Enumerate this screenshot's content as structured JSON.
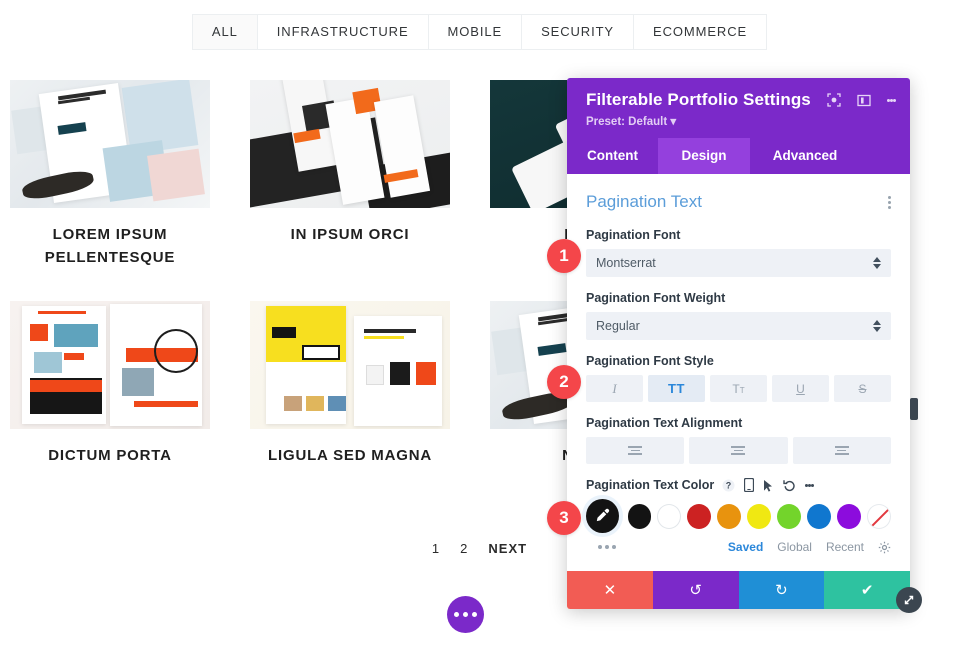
{
  "filter_bar": {
    "items": [
      {
        "label": "ALL",
        "active": true
      },
      {
        "label": "INFRASTRUCTURE",
        "active": false
      },
      {
        "label": "MOBILE",
        "active": false
      },
      {
        "label": "SECURITY",
        "active": false
      },
      {
        "label": "ECOMMERCE",
        "active": false
      }
    ]
  },
  "portfolio": {
    "items": [
      {
        "title": "LOREM IPSUM PELLENTESQUE",
        "thumb": "sunglasses-shop-mockup"
      },
      {
        "title": "IN IPSUM ORCI",
        "thumb": "mobile-app-orange-mockup"
      },
      {
        "title": "IPSUM",
        "thumb": "dark-teal-phone-mockup"
      },
      {
        "title": "DICTUM PORTA",
        "thumb": "bike-repair-orange-mockup"
      },
      {
        "title": "LIGULA SED MAGNA",
        "thumb": "yellow-strategy-mockup"
      },
      {
        "title": "NIBH P",
        "thumb": "sunglasses-shop-mockup-2"
      }
    ]
  },
  "pagination": {
    "pages": [
      "1",
      "2"
    ],
    "next_label": "NEXT"
  },
  "fab": {
    "name": "more-options-fab"
  },
  "markers": [
    {
      "number": "1"
    },
    {
      "number": "2"
    },
    {
      "number": "3"
    }
  ],
  "panel": {
    "title": "Filterable Portfolio Settings",
    "preset": "Preset: Default",
    "header_icons": [
      "focus-icon",
      "layout-columns-icon",
      "kebab-menu-icon"
    ],
    "tabs": [
      {
        "label": "Content",
        "active": false
      },
      {
        "label": "Design",
        "active": true
      },
      {
        "label": "Advanced",
        "active": false
      }
    ],
    "section": {
      "title": "Pagination Text"
    },
    "font": {
      "label": "Pagination Font",
      "value": "Montserrat"
    },
    "font_weight": {
      "label": "Pagination Font Weight",
      "value": "Regular"
    },
    "font_style": {
      "label": "Pagination Font Style",
      "options": [
        {
          "name": "italic",
          "glyph": "I",
          "active": false
        },
        {
          "name": "uppercase",
          "glyph": "TT",
          "active": true
        },
        {
          "name": "small-caps",
          "glyph": "T",
          "sub": "T",
          "active": false
        },
        {
          "name": "underline",
          "glyph": "U",
          "active": false
        },
        {
          "name": "strikethrough",
          "glyph": "S",
          "active": false
        }
      ]
    },
    "text_alignment": {
      "label": "Pagination Text Alignment",
      "options": [
        {
          "name": "align-left",
          "active": false
        },
        {
          "name": "align-center",
          "active": false
        },
        {
          "name": "align-right",
          "active": false
        }
      ]
    },
    "text_color": {
      "label": "Pagination Text Color",
      "inline_icons": [
        "help-icon",
        "mobile-icon",
        "cursor-icon",
        "reset-icon",
        "kebab-icon"
      ],
      "picker": "eyedropper-icon",
      "swatches": [
        {
          "name": "black",
          "hex": "#131313"
        },
        {
          "name": "white",
          "hex": "#ffffff"
        },
        {
          "name": "red",
          "hex": "#cc2222"
        },
        {
          "name": "orange",
          "hex": "#e8930e"
        },
        {
          "name": "yellow",
          "hex": "#f0e812"
        },
        {
          "name": "green",
          "hex": "#73d42b"
        },
        {
          "name": "blue",
          "hex": "#1077cf"
        },
        {
          "name": "purple",
          "hex": "#8c0cdd"
        },
        {
          "name": "none",
          "hex": "transparent"
        }
      ],
      "source_tabs": [
        {
          "label": "Saved",
          "active": true
        },
        {
          "label": "Global",
          "active": false
        },
        {
          "label": "Recent",
          "active": false
        }
      ],
      "settings_icon": "gear-icon"
    },
    "footer": [
      {
        "name": "cancel",
        "glyph": "✕",
        "color": "#f25c54"
      },
      {
        "name": "undo",
        "glyph": "↺",
        "color": "#7b29c9"
      },
      {
        "name": "redo",
        "glyph": "↻",
        "color": "#1f8fd6"
      },
      {
        "name": "save",
        "glyph": "✔",
        "color": "#2ec2a0"
      }
    ],
    "resize_handle": "resize-handle-icon",
    "accent_color": "#7b29c9"
  }
}
